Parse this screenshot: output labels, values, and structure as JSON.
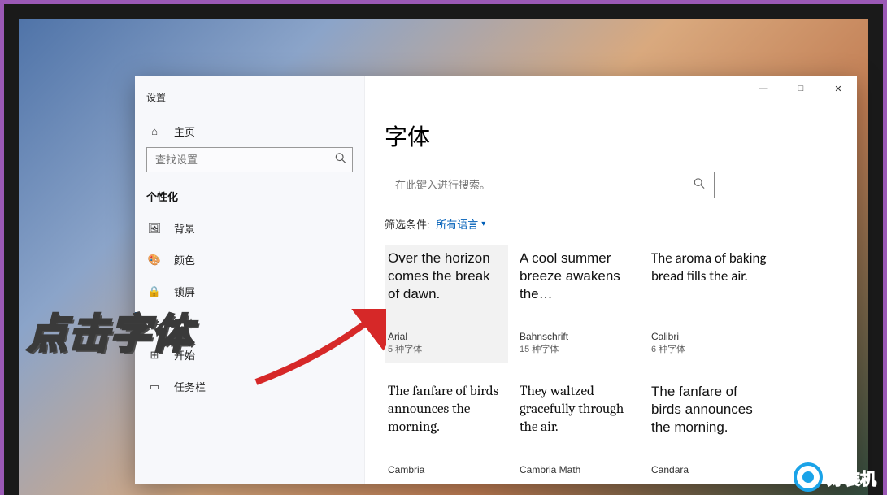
{
  "app_name": "设置",
  "window_controls": {
    "minimize": "—",
    "maximize": "□",
    "close": "✕"
  },
  "sidebar": {
    "home_icon": "⌂",
    "home_label": "主页",
    "search_placeholder": "查找设置",
    "category": "个性化",
    "items": [
      {
        "icon": "🖼",
        "label": "背景"
      },
      {
        "icon": "🎨",
        "label": "颜色"
      },
      {
        "icon": "🔒",
        "label": "锁屏"
      },
      {
        "icon": "Aᴀ",
        "label": "字体"
      },
      {
        "icon": "⊞",
        "label": "开始"
      },
      {
        "icon": "▭",
        "label": "任务栏"
      }
    ]
  },
  "page": {
    "title": "字体",
    "search_placeholder": "在此键入进行搜索。",
    "filter_label": "筛选条件:",
    "filter_value": "所有语言"
  },
  "fonts": [
    {
      "sample": "Over the horizon comes the break of dawn.",
      "name": "Arial",
      "count": "5 种字体",
      "family": "Arial, sans-serif",
      "selected": true
    },
    {
      "sample": "A cool summer breeze awakens the…",
      "name": "Bahnschrift",
      "count": "15 种字体",
      "family": "Bahnschrift, sans-serif"
    },
    {
      "sample": "The aroma of baking bread fills the air.",
      "name": "Calibri",
      "count": "6 种字体",
      "family": "Calibri, sans-serif"
    },
    {
      "sample": "The fanfare of birds announces the morning.",
      "name": "Cambria",
      "count": "",
      "family": "Cambria, serif"
    },
    {
      "sample": "They waltzed gracefully through the air.",
      "name": "Cambria Math",
      "count": "",
      "family": "'Cambria Math', Cambria, serif"
    },
    {
      "sample": "The fanfare of birds announces the morning.",
      "name": "Candara",
      "count": "",
      "family": "Candara, sans-serif"
    }
  ],
  "overlay": {
    "caption": "点击字体",
    "watermark": "好装机"
  }
}
